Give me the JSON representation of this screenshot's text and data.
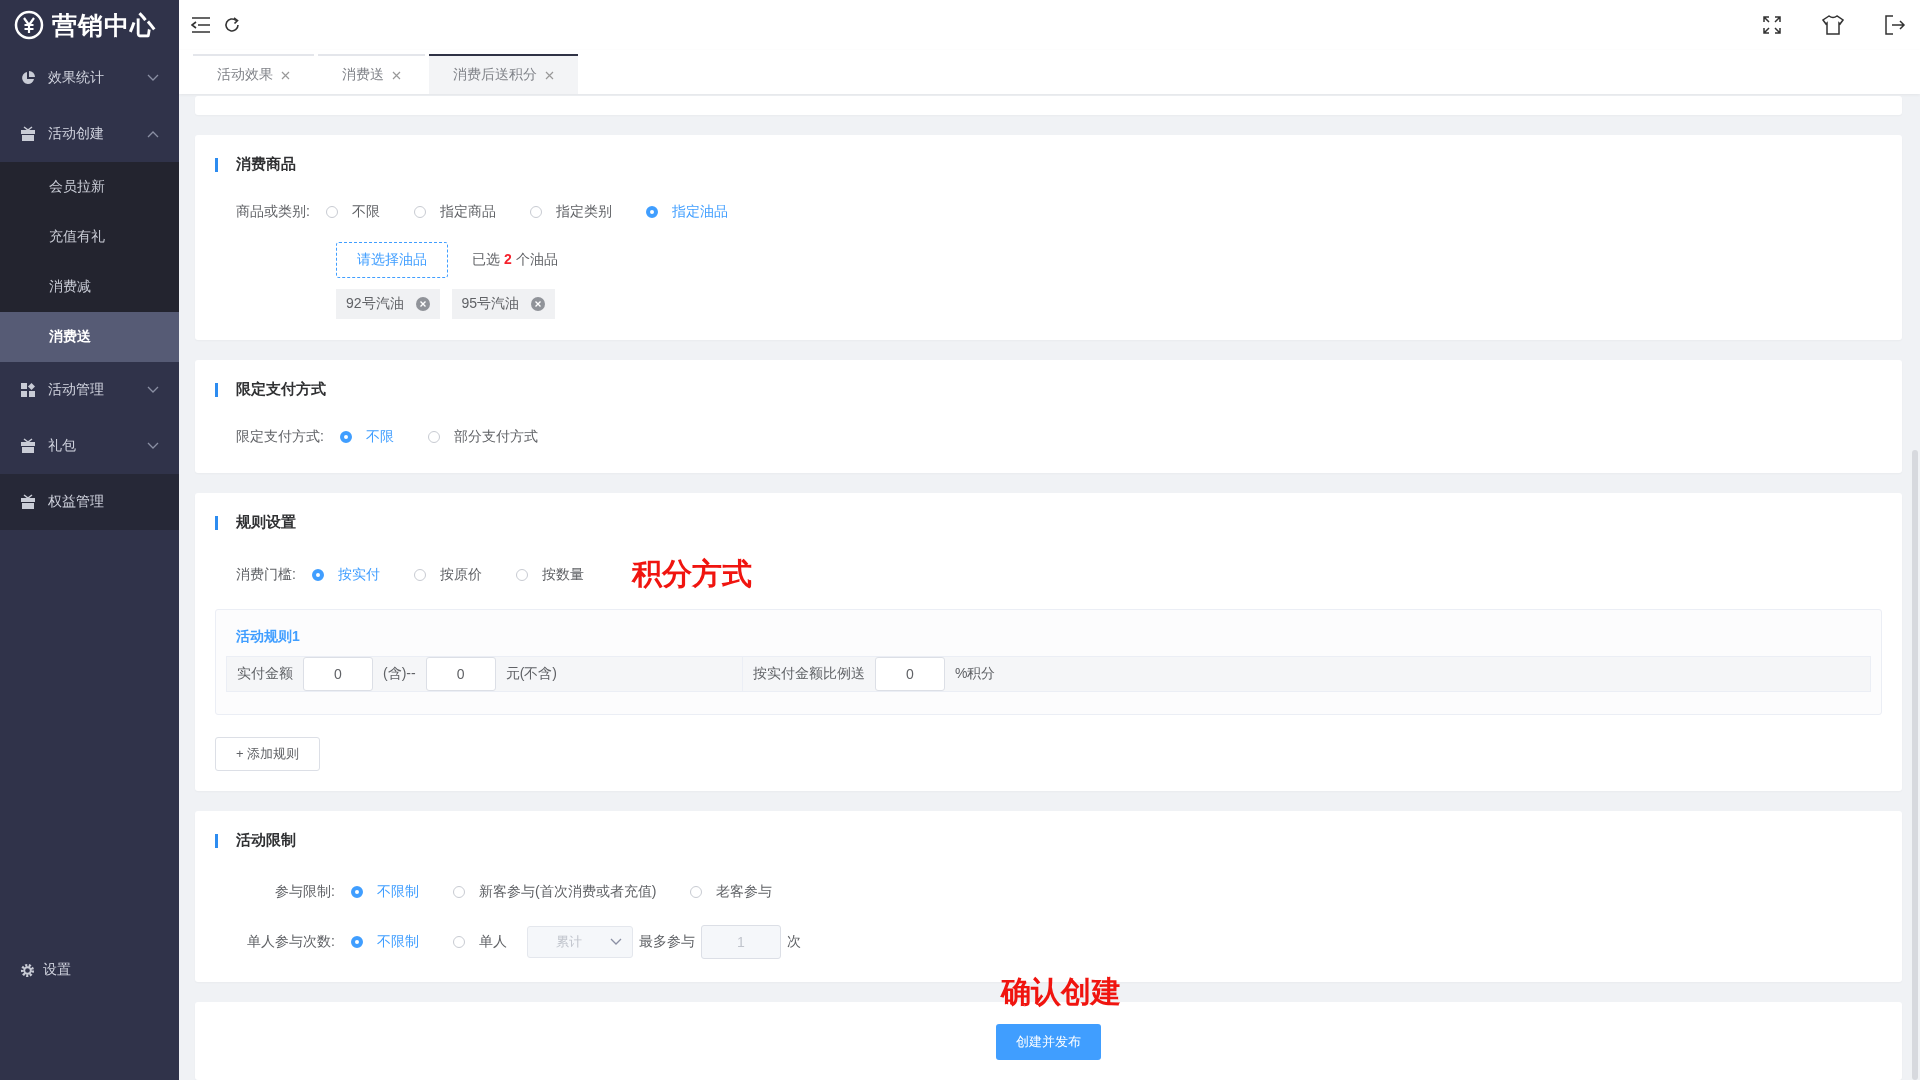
{
  "sidebar": {
    "logo": "营销中心",
    "items": [
      {
        "label": "效果统计",
        "kind": "group",
        "expanded": false
      },
      {
        "label": "活动创建",
        "kind": "group",
        "expanded": true,
        "children": [
          {
            "label": "会员拉新",
            "selected": false
          },
          {
            "label": "充值有礼",
            "selected": false
          },
          {
            "label": "消费减",
            "selected": false
          },
          {
            "label": "消费送",
            "selected": true
          }
        ]
      },
      {
        "label": "活动管理",
        "kind": "group",
        "expanded": false
      },
      {
        "label": "礼包",
        "kind": "group",
        "expanded": false
      },
      {
        "label": "权益管理",
        "kind": "link"
      }
    ],
    "footer": "设置"
  },
  "tabs": [
    {
      "label": "活动效果",
      "selected": false
    },
    {
      "label": "消费送",
      "selected": false
    },
    {
      "label": "消费后送积分",
      "selected": true
    }
  ],
  "goods": {
    "title": "消费商品",
    "label": "商品或类别:",
    "options": [
      {
        "label": "不限",
        "selected": false
      },
      {
        "label": "指定商品",
        "selected": false
      },
      {
        "label": "指定类别",
        "selected": false
      },
      {
        "label": "指定油品",
        "selected": true
      }
    ],
    "pick_button": "请选择油品",
    "picked_prefix": "已选",
    "picked_count": "2",
    "picked_suffix": "个油品",
    "tags": [
      "92号汽油",
      "95号汽油"
    ]
  },
  "payment": {
    "title": "限定支付方式",
    "label": "限定支付方式:",
    "options": [
      {
        "label": "不限",
        "selected": true
      },
      {
        "label": "部分支付方式",
        "selected": false
      }
    ]
  },
  "rules": {
    "title": "规则设置",
    "label": "消费门槛:",
    "options": [
      {
        "label": "按实付",
        "selected": true
      },
      {
        "label": "按原价",
        "selected": false
      },
      {
        "label": "按数量",
        "selected": false
      }
    ],
    "annotation": "积分方式",
    "rule_title": "活动规则1",
    "rule": {
      "amount_label": "实付金额",
      "from": "0",
      "from_suffix": "(含)--",
      "to": "0",
      "to_suffix": "元(不含)",
      "ratio_label": "按实付金额比例送",
      "ratio": "0",
      "ratio_suffix": "%积分"
    },
    "add_button": "+ 添加规则"
  },
  "limits": {
    "title": "活动限制",
    "join_label": "参与限制:",
    "join_options": [
      {
        "label": "不限制",
        "selected": true
      },
      {
        "label": "新客参与(首次消费或者充值)",
        "selected": false
      },
      {
        "label": "老客参与",
        "selected": false
      }
    ],
    "count_label": "单人参与次数:",
    "count_options": [
      {
        "label": "不限制",
        "selected": true
      },
      {
        "label": "单人",
        "selected": false
      }
    ],
    "period_select": {
      "value": "累计",
      "disabled": true
    },
    "max_label": "最多参与",
    "max_input": {
      "value": "1",
      "disabled": true
    },
    "max_suffix": "次"
  },
  "footer": {
    "annotation": "确认创建",
    "submit_button": "创建并发布"
  }
}
